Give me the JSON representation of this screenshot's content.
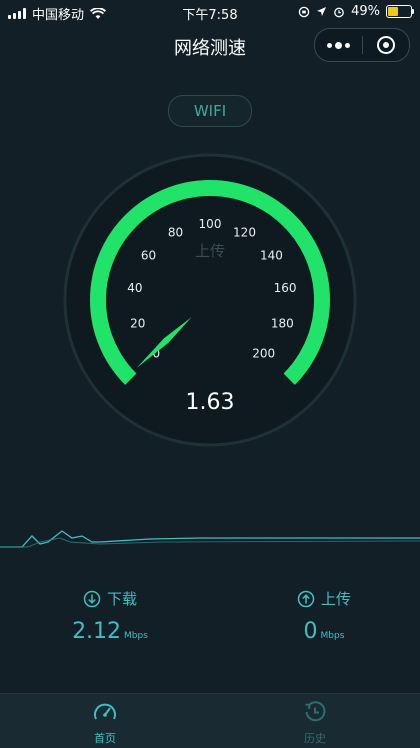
{
  "status_bar": {
    "carrier": "中国移动",
    "time": "下午7:58",
    "battery_percent": "49%",
    "battery_level": 0.49,
    "battery_color": "#f5c518"
  },
  "nav": {
    "title": "网络测速"
  },
  "network_type": "WIFI",
  "gauge": {
    "mode_label": "上传",
    "value": "1.63",
    "value_numeric": 1.63,
    "min": 0,
    "max": 200,
    "tick_labels": [
      "0",
      "20",
      "40",
      "60",
      "80",
      "100",
      "120",
      "140",
      "160",
      "180",
      "200"
    ],
    "arc_color": "#21e36a"
  },
  "download": {
    "label": "下载",
    "value": "2.12",
    "unit": "Mbps",
    "icon": "download-arrow-icon"
  },
  "upload": {
    "label": "上传",
    "value": "0",
    "unit": "Mbps",
    "icon": "upload-arrow-icon"
  },
  "tabs": [
    {
      "label": "首页",
      "active": true,
      "icon": "speedometer-icon"
    },
    {
      "label": "历史",
      "active": false,
      "icon": "history-icon"
    }
  ],
  "colors": {
    "accent": "#3fbfc4",
    "background": "#121f27"
  }
}
